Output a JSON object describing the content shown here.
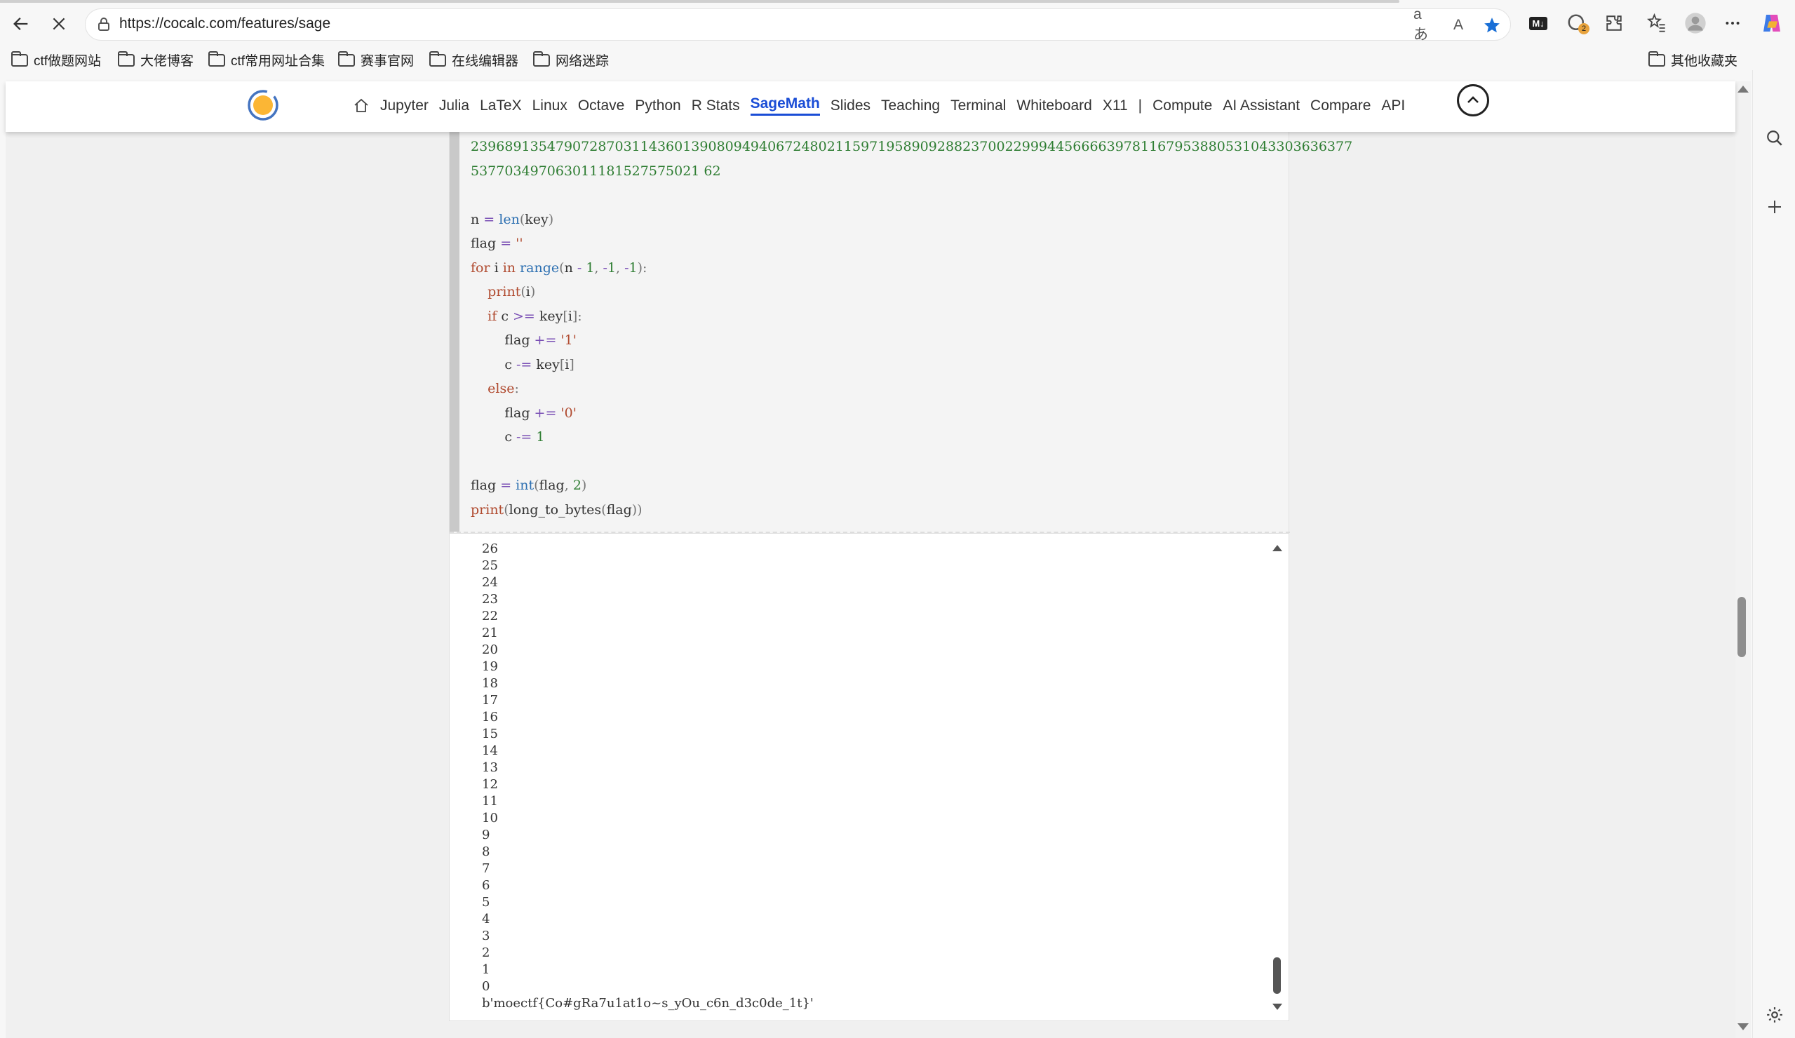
{
  "browser": {
    "url": "https://cocalc.com/features/sage",
    "bookmarks": [
      "ctf做题网站",
      "大佬博客",
      "ctf常用网址合集",
      "赛事官网",
      "在线编辑器",
      "网络迷踪"
    ],
    "other_bookmarks": "其他收藏夹",
    "extension_badge": "2",
    "read_aloud_label": "A",
    "translate_label": "aあ",
    "md_label": "M↓"
  },
  "site": {
    "nav": [
      "Jupyter",
      "Julia",
      "LaTeX",
      "Linux",
      "Octave",
      "Python",
      "R Stats",
      "SageMath",
      "Slides",
      "Teaching",
      "Terminal",
      "Whiteboard",
      "X11",
      "|",
      "Compute",
      "AI Assistant",
      "Compare",
      "API"
    ],
    "active_nav": "SageMath"
  },
  "code": {
    "number_line1": "23968913547907287031143601390809494067248021159719589092882370022999445666639781167953880531043303636377",
    "number_line2": "537703497063011181527575021 62",
    "lines": [
      "n = len(key)",
      "flag = ''",
      "for i in range(n - 1, -1, -1):",
      "    print(i)",
      "    if c >= key[i]:",
      "        flag += '1'",
      "        c -= key[i]",
      "    else:",
      "        flag += '0'",
      "        c -= 1",
      "",
      "flag = int(flag, 2)",
      "print(long_to_bytes(flag))"
    ]
  },
  "output": {
    "numbers": [
      "26",
      "25",
      "24",
      "23",
      "22",
      "21",
      "20",
      "19",
      "18",
      "17",
      "16",
      "15",
      "14",
      "13",
      "12",
      "11",
      "10",
      "9",
      "8",
      "7",
      "6",
      "5",
      "4",
      "3",
      "2",
      "1",
      "0"
    ],
    "result": "b'moectf{Co#gRa7u1at1o~s_yOu_c6n_d3c0de_1t}'"
  }
}
